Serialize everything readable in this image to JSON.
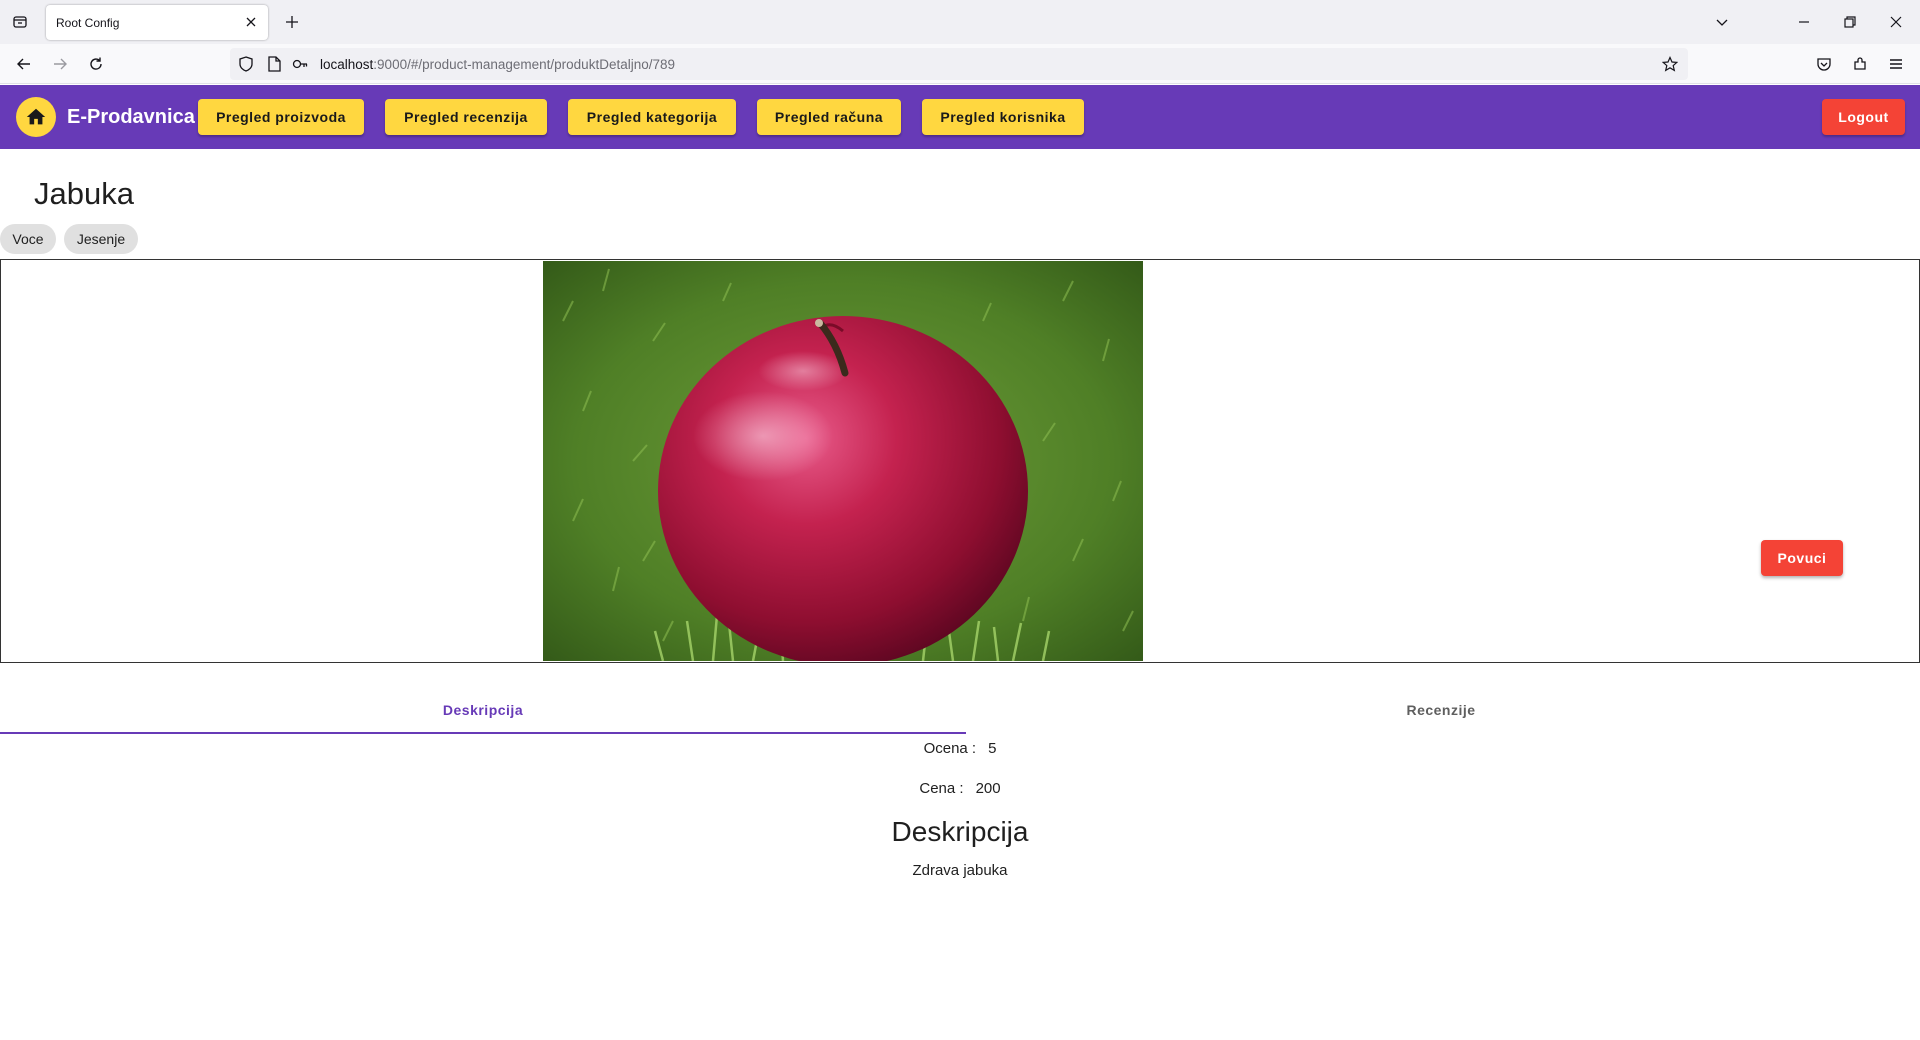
{
  "browser": {
    "tab_title": "Root Config",
    "url_host": "localhost",
    "url_rest": ":9000/#/product-management/produktDetaljno/789"
  },
  "app": {
    "brand": "E-Prodavnica",
    "nav": [
      {
        "label": "Pregled proizvoda"
      },
      {
        "label": "Pregled recenzija"
      },
      {
        "label": "Pregled kategorija"
      },
      {
        "label": "Pregled računa"
      },
      {
        "label": "Pregled korisnika"
      }
    ],
    "logout_label": "Logout",
    "colors": {
      "toolbar": "#673ab7",
      "accent": "#ffd740",
      "warn": "#f44336"
    }
  },
  "product": {
    "name": "Jabuka",
    "tags": [
      "Voce",
      "Jesenje"
    ],
    "image_alt": "apple",
    "buy_label": "Povuci",
    "tabs": [
      {
        "label": "Deskripcija",
        "active": true
      },
      {
        "label": "Recenzije",
        "active": false
      }
    ],
    "rating_label": "Ocena :",
    "rating_value": "5",
    "price_label": "Cena :",
    "price_value": "200",
    "description_heading": "Deskripcija",
    "description_text": "Zdrava jabuka"
  },
  "icons": [
    "tab-list-icon",
    "close-icon",
    "plus-icon",
    "chevron-down-icon",
    "minimize-icon",
    "restore-icon",
    "back-icon",
    "forward-icon",
    "reload-icon",
    "shield-icon",
    "page-icon",
    "key-icon",
    "star-icon",
    "pocket-icon",
    "extensions-icon",
    "menu-icon",
    "home-icon"
  ]
}
